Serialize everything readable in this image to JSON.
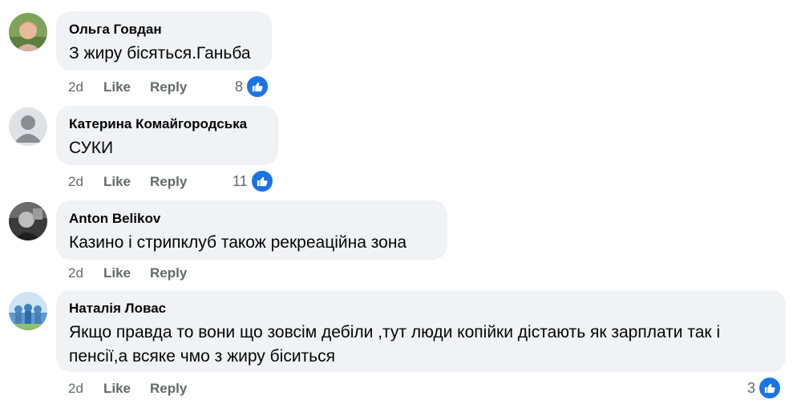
{
  "comments": [
    {
      "author": "Ольга Говдан",
      "text": "З жиру бісяться.Ганьба",
      "time": "2d",
      "like_label": "Like",
      "reply_label": "Reply",
      "reactions": "8",
      "avatar_icon": "user-photo-avatar"
    },
    {
      "author": "Катерина Комайгородська",
      "text": "СУКИ",
      "time": "2d",
      "like_label": "Like",
      "reply_label": "Reply",
      "reactions": "11",
      "avatar_icon": "default-user-avatar"
    },
    {
      "author": "Anton Belikov",
      "text": "Казино і стрипклуб також рекреаційна зона",
      "time": "2d",
      "like_label": "Like",
      "reply_label": "Reply",
      "avatar_icon": "user-photo-avatar"
    },
    {
      "author": "Наталія Ловас",
      "text": "Якщо правда то вони що зовсім дебіли ,тут люди копійки дістають як зарплати так і\nпенсії,а всяке чмо з жиру біситься",
      "time": "2d",
      "like_label": "Like",
      "reply_label": "Reply",
      "reactions": "3",
      "avatar_icon": "user-photo-avatar"
    }
  ],
  "colors": {
    "bubble": "#f0f2f5",
    "meta": "#65676b",
    "like_badge": "#1b74e4"
  }
}
